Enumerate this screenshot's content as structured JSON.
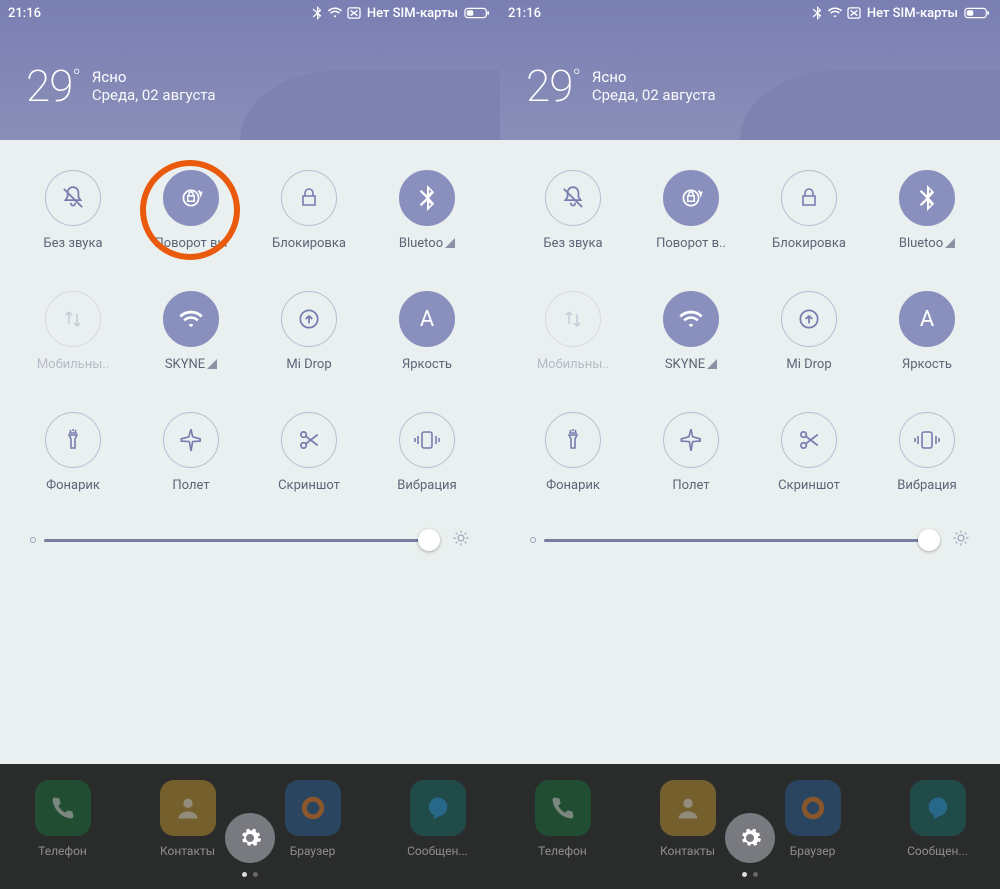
{
  "status": {
    "time": "21:16",
    "no_sim": "Нет SIM-карты"
  },
  "weather": {
    "temp": "29",
    "degree": "°",
    "cond": "Ясно",
    "date": "Среда, 02 августа"
  },
  "tiles": {
    "mute": "Без звука",
    "rotate": "Поворот вы",
    "rotate2": "Поворот в..",
    "lock": "Блокировка",
    "bluetooth": "Bluetoo",
    "mobile": "Мобильны..",
    "wifi": "SKYNE",
    "midrop": "Mi Drop",
    "brightness": "Яркость",
    "flashlight": "Фонарик",
    "airplane": "Полет",
    "screenshot": "Скриншот",
    "vibrate": "Вибрация"
  },
  "dock": {
    "phone": "Телефон",
    "contacts": "Контакты",
    "browser": "Браузер",
    "messages": "Сообщен..."
  },
  "brightness_letter": "A"
}
